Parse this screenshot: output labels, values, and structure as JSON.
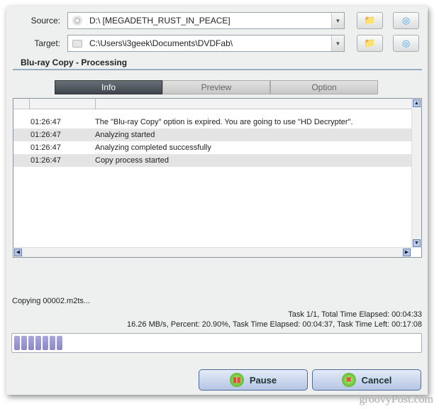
{
  "source": {
    "label": "Source:",
    "value": "D:\\ [MEGADETH_RUST_IN_PEACE]"
  },
  "target": {
    "label": "Target:",
    "value": "C:\\Users\\i3geek\\Documents\\DVDFab\\"
  },
  "section_title": "Blu-ray Copy  -  Processing",
  "tabs": [
    {
      "label": "Info",
      "active": true
    },
    {
      "label": "Preview"
    },
    {
      "label": "Option"
    }
  ],
  "log": [
    {
      "time": "01:26:47",
      "message": "The \"Blu-ray Copy\" option is expired. You are going to use \"HD Decrypter\"."
    },
    {
      "time": "01:26:47",
      "message": "Analyzing started"
    },
    {
      "time": "01:26:47",
      "message": "Analyzing completed successfully"
    },
    {
      "time": "01:26:47",
      "message": "Copy process started"
    }
  ],
  "status": {
    "current_file": "Copying 00002.m2ts...",
    "line1": "Task 1/1,  Total Time Elapsed: 00:04:33",
    "line2": "16.26 MB/s,  Percent: 20.90%,  Task Time Elapsed: 00:04:37,  Task Time Left: 00:17:08",
    "progress_percent": 20.9
  },
  "buttons": {
    "pause": "Pause",
    "cancel": "Cancel"
  },
  "watermark": "groovyPost.com",
  "colors": {
    "progress_block": "#8b89c4",
    "button_top": "#e3ebf8",
    "button_bottom": "#b5c6e4"
  }
}
